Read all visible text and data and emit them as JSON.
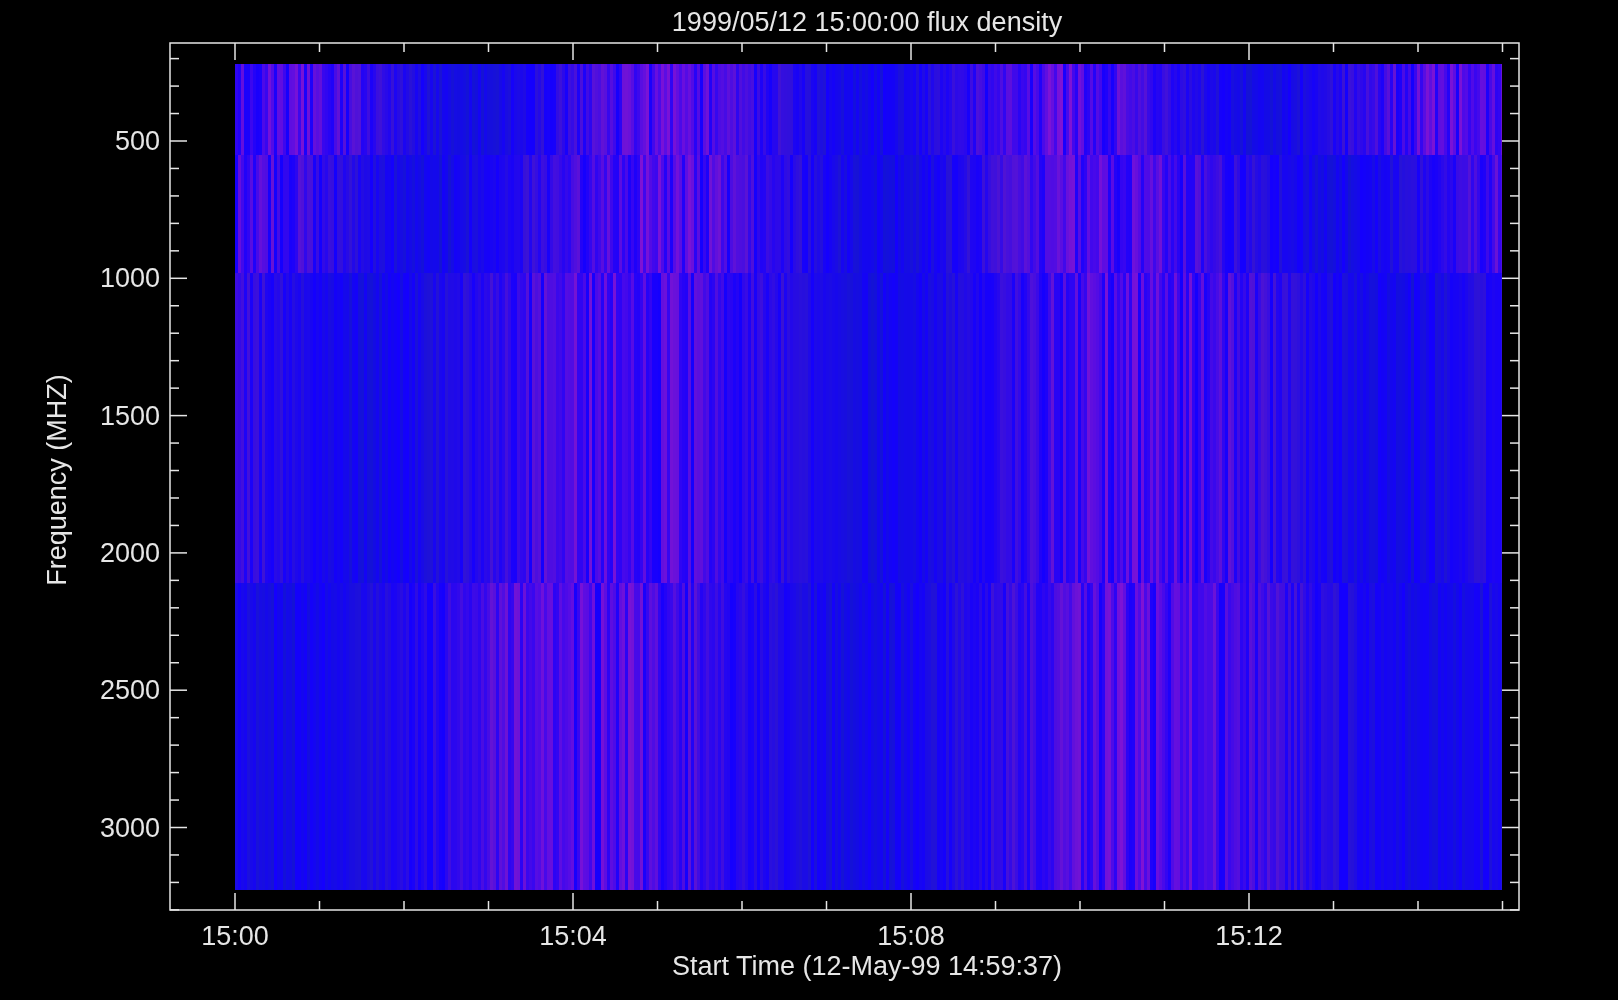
{
  "title": "1999/05/12 15:00:00 flux density",
  "y_axis": {
    "label": "Frequency (MHZ)",
    "ticks": [
      "500",
      "1000",
      "1500",
      "2000",
      "2500",
      "3000"
    ]
  },
  "x_axis": {
    "label": "Start Time (12-May-99 14:59:37)",
    "ticks": [
      "15:00",
      "15:04",
      "15:08",
      "15:12"
    ]
  }
}
